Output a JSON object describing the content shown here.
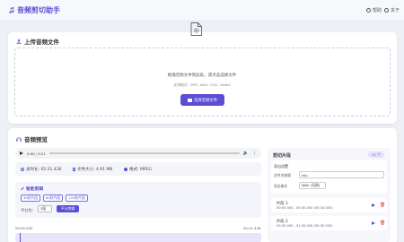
{
  "header": {
    "title": "音频剪切助手",
    "help_label": "帮助",
    "about_label": "关于"
  },
  "upload": {
    "title": "上传音频文件",
    "drop_text": "拖拽音频文件到此处，或点击选择文件",
    "formats_text": "支持格式：MP3, WAV, OGG, WebM",
    "button_label": "选择音频文件"
  },
  "preview": {
    "title": "音频预览",
    "player": {
      "time_text": "0:00 / 5:21"
    },
    "info": {
      "duration_label": "总时长: 05:21.436",
      "size_label": "文件大小: 4.91 MB",
      "format_label": "格式: MPEG"
    },
    "smart": {
      "title": "智能剪辑",
      "buttons": [
        "30秒片段",
        "60秒片段",
        "120秒片段"
      ],
      "split_label": "平分为:",
      "split_value": "3段",
      "split_button": "平分剪辑"
    },
    "ruler": {
      "start": "00:00.000",
      "end": "05:21.436"
    }
  },
  "clips": {
    "title": "剪切片段",
    "count": "11 个",
    "export": {
      "title": "导出设置",
      "name_label": "文件名前缀",
      "name_value": "clip",
      "format_label": "导出格式",
      "format_value": "WAV (无损)"
    },
    "items": [
      {
        "name": "片段 1",
        "range": "00:00.000 - 00:30.000 (00:30.000)"
      },
      {
        "name": "片段 2",
        "range": "00:30.000 - 01:00.000 (00:30.000)"
      }
    ]
  },
  "colors": {
    "accent": "#5b4ed6",
    "danger": "#e0403d",
    "background": "#eef0f7"
  }
}
